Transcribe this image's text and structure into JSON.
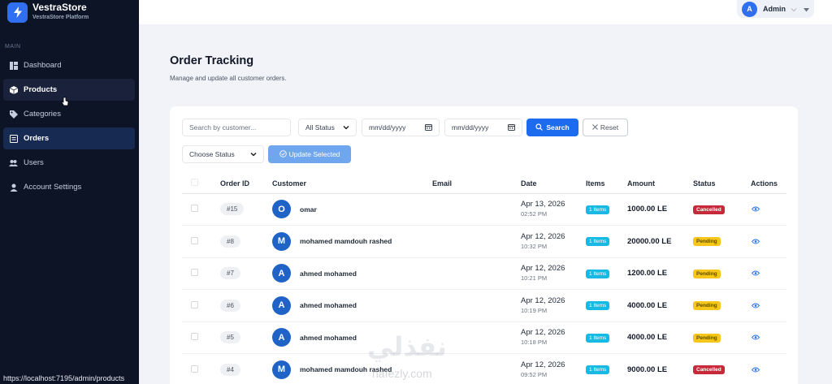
{
  "brand": {
    "name": "VestraStore",
    "subtitle": "VestraStore Platform",
    "accent": "#2f6ff0"
  },
  "sidebar": {
    "section_label": "MAIN",
    "items": [
      {
        "label": "Dashboard",
        "icon": "dashboard-icon",
        "state": "normal"
      },
      {
        "label": "Products",
        "icon": "box-icon",
        "state": "hover"
      },
      {
        "label": "Categories",
        "icon": "tag-icon",
        "state": "normal"
      },
      {
        "label": "Orders",
        "icon": "receipt-icon",
        "state": "active"
      },
      {
        "label": "Users",
        "icon": "users-icon",
        "state": "normal"
      },
      {
        "label": "Account Settings",
        "icon": "user-icon",
        "state": "normal"
      }
    ]
  },
  "status_bar": {
    "url": "https://localhost:7195/admin/products"
  },
  "topbar": {
    "user_initial": "A",
    "user_name": "Admin"
  },
  "page": {
    "title": "Order Tracking",
    "subtitle": "Manage and update all customer orders."
  },
  "filters": {
    "search_placeholder": "Search by customer...",
    "status_select": "All Status",
    "date_from_placeholder": "mm/dd/yyyy",
    "date_to_placeholder": "mm/dd/yyyy",
    "search_label": "Search",
    "reset_label": "Reset",
    "bulk_status_select": "Choose Status",
    "update_selected_label": "Update Selected"
  },
  "table": {
    "columns": [
      "Order ID",
      "Customer",
      "Email",
      "Date",
      "Items",
      "Amount",
      "Status",
      "Actions"
    ],
    "rows": [
      {
        "order_id": "#15",
        "initial": "O",
        "customer": "omar",
        "email": "",
        "date": "Apr 13, 2026",
        "time": "02:52 PM",
        "items": "1 Items",
        "amount": "1000.00 LE",
        "status": "Cancelled"
      },
      {
        "order_id": "#8",
        "initial": "M",
        "customer": "mohamed mamdouh rashed",
        "email": "",
        "date": "Apr 12, 2026",
        "time": "10:32 PM",
        "items": "1 Items",
        "amount": "20000.00 LE",
        "status": "Pending"
      },
      {
        "order_id": "#7",
        "initial": "A",
        "customer": "ahmed mohamed",
        "email": "",
        "date": "Apr 12, 2026",
        "time": "10:21 PM",
        "items": "1 Items",
        "amount": "1200.00 LE",
        "status": "Pending"
      },
      {
        "order_id": "#6",
        "initial": "A",
        "customer": "ahmed mohamed",
        "email": "",
        "date": "Apr 12, 2026",
        "time": "10:19 PM",
        "items": "1 Items",
        "amount": "4000.00 LE",
        "status": "Pending"
      },
      {
        "order_id": "#5",
        "initial": "A",
        "customer": "ahmed mohamed",
        "email": "",
        "date": "Apr 12, 2026",
        "time": "10:18 PM",
        "items": "1 Items",
        "amount": "4000.00 LE",
        "status": "Pending"
      },
      {
        "order_id": "#4",
        "initial": "M",
        "customer": "mohamed mamdouh rashed",
        "email": "",
        "date": "Apr 12, 2026",
        "time": "09:52 PM",
        "items": "1 Items",
        "amount": "9000.00 LE",
        "status": "Cancelled"
      }
    ]
  },
  "watermark": {
    "arabic": "نفذلي",
    "latin": "nafezly.com"
  },
  "colors": {
    "sidebar_bg": "#0d1426",
    "primary": "#1d6cf0",
    "cancelled": "#c62a3a",
    "pending": "#f7c61b",
    "items_badge": "#18b9e3"
  }
}
